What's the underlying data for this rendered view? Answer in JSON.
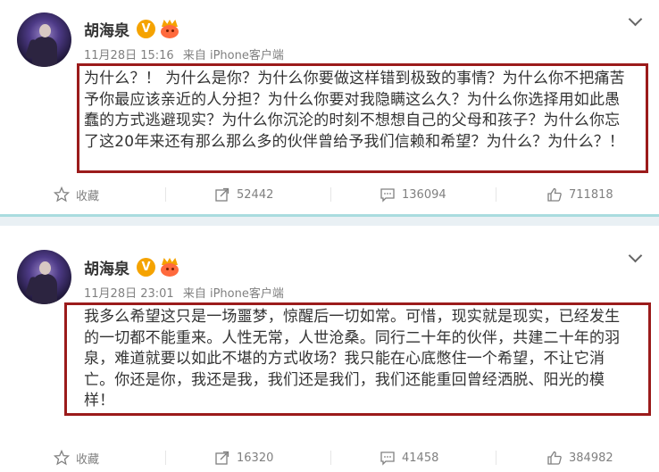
{
  "posts": [
    {
      "username": "胡海泉",
      "vip_badge": "V",
      "date": "11月28日",
      "time": "15:16",
      "source": "来自 iPhone客户端",
      "lines": [
        "为什么？！ 为什么是你？为什么你要做这样错到极致的事情？为什么你不把痛苦",
        "予你最应该亲近的人分担？为什么你要对我隐瞒这么久？为什么你选择用如此愚",
        "蠢的方式逃避现实？为什么你沉沦的时刻不想想自己的父母和孩子？为什么你忘",
        "了这20年来还有那么那么多的伙伴曾给予我们信赖和希望？为什么？为什么？！"
      ],
      "actions": {
        "favorite": "收藏",
        "repost": "52442",
        "comment": "136094",
        "like": "711818"
      }
    },
    {
      "username": "胡海泉",
      "vip_badge": "V",
      "date": "11月28日",
      "time": "23:01",
      "source": "来自 iPhone客户端",
      "lines": [
        "我多么希望这只是一场噩梦，惊醒后一切如常。可惜，现实就是现实，已经发生",
        "的一切都不能重来。人性无常，人世沧桑。同行二十年的伙伴，共建二十年的羽",
        "泉，难道就要以如此不堪的方式收场？我只能在心底憋住一个希望，不让它消",
        "亡。你还是你，我还是我，我们还是我们，我们还能重回曾经洒脱、阳光的模",
        "样！"
      ],
      "actions": {
        "favorite": "收藏",
        "repost": "16320",
        "comment": "41458",
        "like": "384982"
      }
    }
  ],
  "colors": {
    "highlight_box": "#9b1b1b",
    "vip_badge": "#f5a300",
    "divider": "#a9dcdf",
    "meta_text": "#808080"
  },
  "icons": [
    "chevron-down-icon",
    "vip-badge-icon",
    "crown-badge-icon",
    "star-icon",
    "share-icon",
    "comment-icon",
    "like-icon"
  ]
}
